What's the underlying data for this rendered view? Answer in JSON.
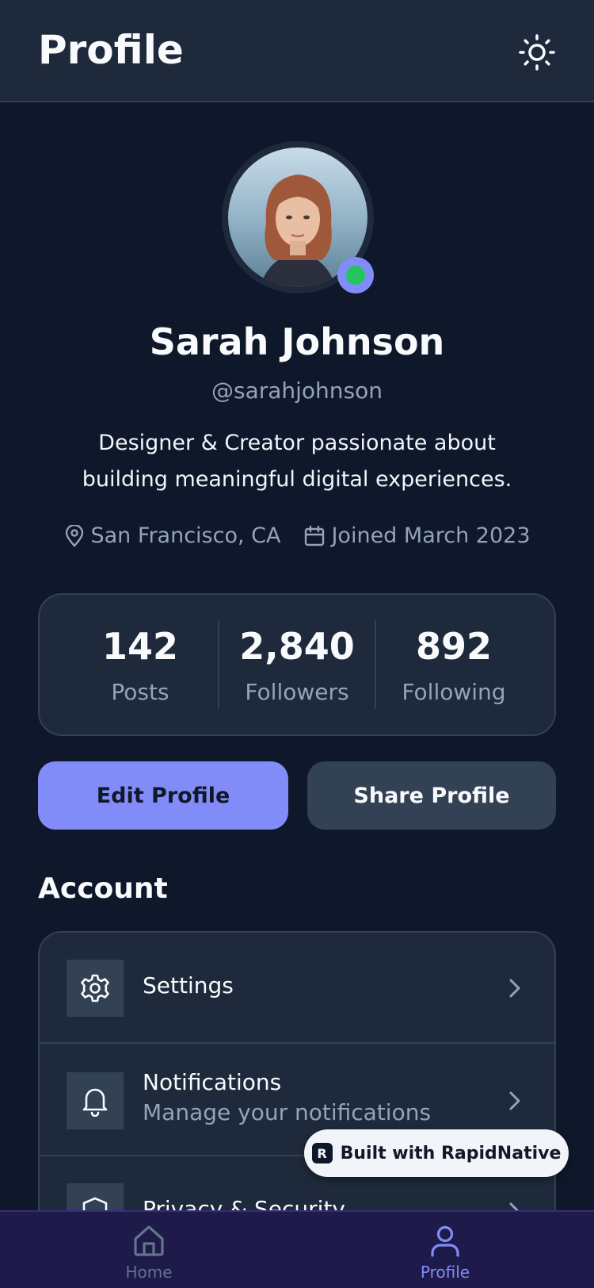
{
  "header": {
    "title": "Profile",
    "theme_icon": "sun-icon"
  },
  "profile": {
    "name": "Sarah Johnson",
    "handle": "@sarahjohnson",
    "bio": "Designer & Creator passionate about building meaningful digital experiences.",
    "location": "San Francisco, CA",
    "joined": "Joined March 2023",
    "status": "online"
  },
  "stats": [
    {
      "value": "142",
      "label": "Posts"
    },
    {
      "value": "2,840",
      "label": "Followers"
    },
    {
      "value": "892",
      "label": "Following"
    }
  ],
  "actions": {
    "edit_label": "Edit Profile",
    "share_label": "Share Profile"
  },
  "account": {
    "title": "Account",
    "items": [
      {
        "label": "Settings",
        "icon": "gear-icon"
      },
      {
        "label": "Notifications",
        "subtitle": "Manage your notifications",
        "icon": "bell-icon"
      },
      {
        "label": "Privacy & Security",
        "icon": "shield-icon"
      }
    ]
  },
  "badge": {
    "text": "Built with RapidNative",
    "logo": "R"
  },
  "tabbar": {
    "items": [
      {
        "label": "Home",
        "icon": "home-icon",
        "active": false
      },
      {
        "label": "Profile",
        "icon": "user-icon",
        "active": true
      }
    ]
  },
  "colors": {
    "background": "#0f172a",
    "surface": "#1e293b",
    "accent": "#818cf8",
    "online": "#22c55e",
    "muted_text": "#94a3b8"
  }
}
